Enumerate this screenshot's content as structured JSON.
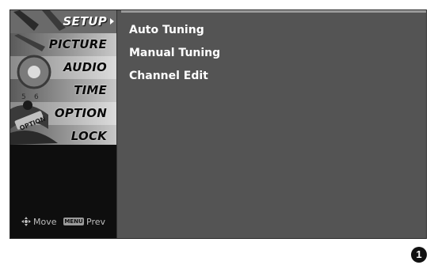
{
  "menu": {
    "items": [
      {
        "label": "SETUP",
        "selected": true
      },
      {
        "label": "PICTURE",
        "selected": false
      },
      {
        "label": "AUDIO",
        "selected": false
      },
      {
        "label": "TIME",
        "selected": false
      },
      {
        "label": "OPTION",
        "selected": false
      },
      {
        "label": "LOCK",
        "selected": false
      }
    ],
    "art_badge_text": "OPTION"
  },
  "footer": {
    "move_icon": "dpad-icon",
    "move_label": "Move",
    "menu_key_label": "MENU",
    "prev_label": "Prev"
  },
  "submenu": {
    "items": [
      "Auto Tuning",
      "Manual Tuning",
      "Channel Edit"
    ]
  },
  "page_number": "1",
  "colors": {
    "screen_bg": "#545454",
    "sidebar_bg": "#0e0e0e",
    "text": "#ffffff"
  }
}
